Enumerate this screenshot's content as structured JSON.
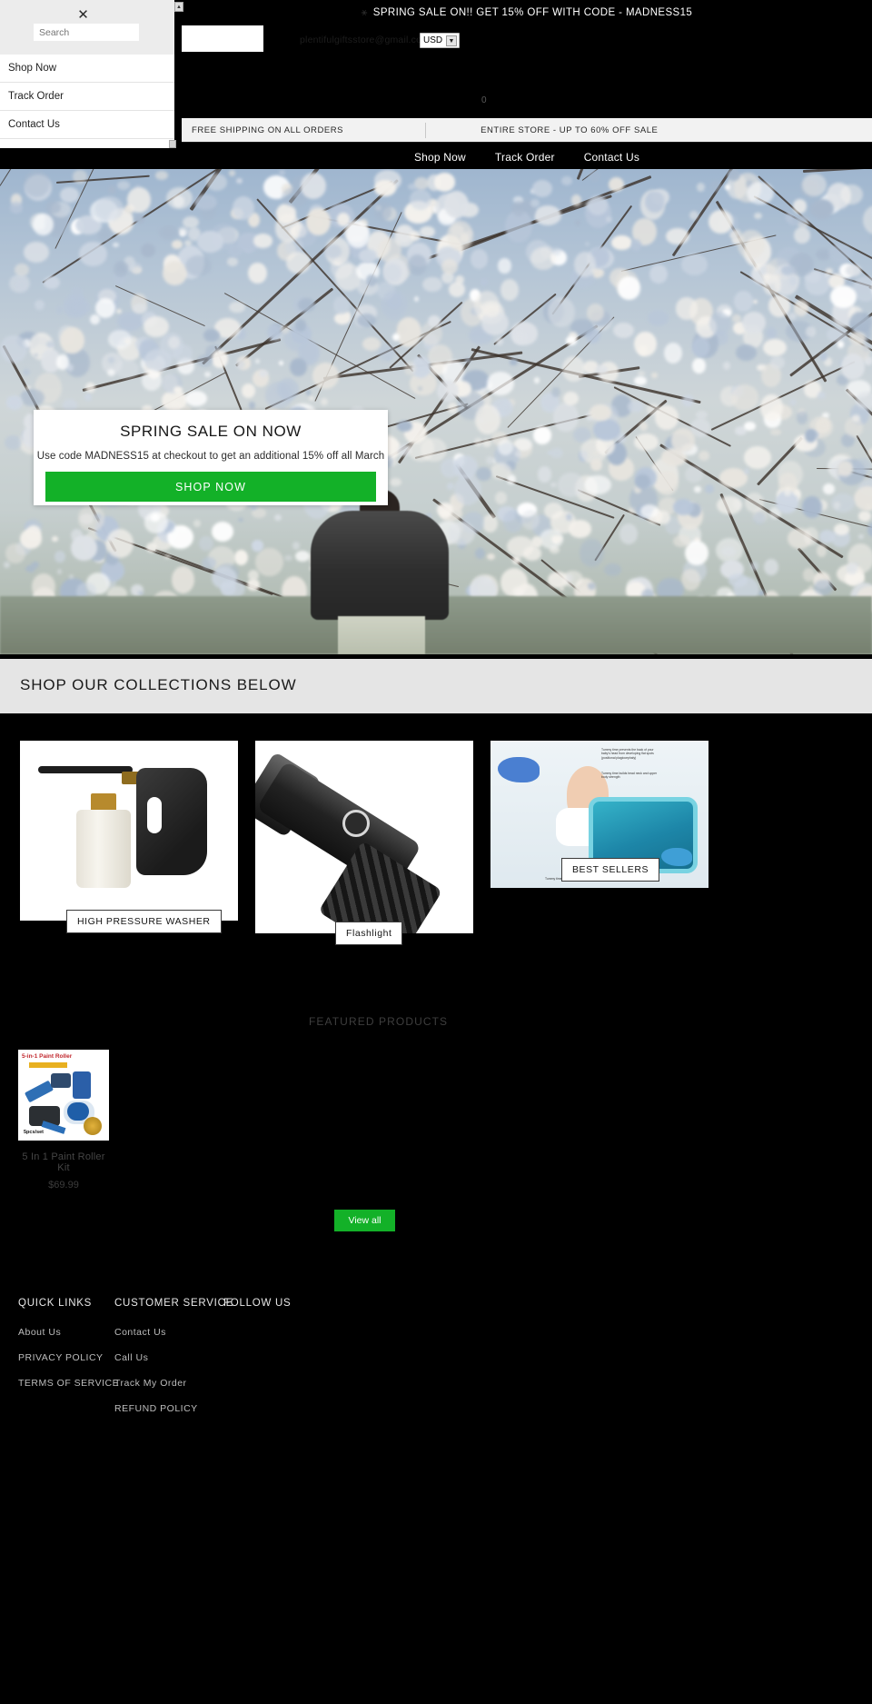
{
  "announcement": {
    "top_text": "SPRING SALE ON!!  GET 15% OFF WITH CODE - MADNESS15",
    "glyph_left": "⚹",
    "glyph_mid": "⚹"
  },
  "utility": {
    "email": "plentifulgiftsstore@gmail.com",
    "currency": "USD",
    "currency_caret": "▼",
    "cart_glyph": "0"
  },
  "info_bar": {
    "left": "FREE SHIPPING ON ALL ORDERS",
    "right": "ENTIRE STORE - UP TO 60% OFF SALE"
  },
  "nav": {
    "items": [
      {
        "label": "Shop Now"
      },
      {
        "label": "Track Order"
      },
      {
        "label": "Contact Us"
      }
    ]
  },
  "hero": {
    "promo_title": "SPRING SALE ON NOW",
    "promo_subtitle": "Use code MADNESS15 at checkout to get an additional 15% off all March",
    "promo_button": "SHOP NOW",
    "accent_green": "#13b128"
  },
  "collections": {
    "heading": "SHOP OUR COLLECTIONS BELOW",
    "cards": [
      {
        "label": "HIGH PRESSURE WASHER"
      },
      {
        "label": "Flashlight"
      },
      {
        "label": "BEST SELLERS"
      }
    ],
    "mat_notes": [
      "Tummy time prevents the back of your baby's head from developing flat spots (positional plagiocephaly)",
      "Tummy time builds head neck and upper body strength",
      "Tummy time improves baby's motor skills"
    ]
  },
  "featured": {
    "heading": "FEATURED PRODUCTS",
    "products": [
      {
        "name": "5 In 1 Paint Roller Kit",
        "price": "$69.99",
        "image_title": "5-in-1 Paint Roller",
        "image_caption": "5pcs/set"
      }
    ],
    "view_all": "View all"
  },
  "footer": {
    "columns": [
      {
        "heading": "QUICK LINKS",
        "links": [
          "About Us",
          "PRIVACY POLICY",
          "TERMS OF SERVICE"
        ]
      },
      {
        "heading": "CUSTOMER SERVICE",
        "links": [
          "Contact Us",
          "Call Us",
          "Track My Order",
          "REFUND POLICY"
        ]
      },
      {
        "heading": "FOLLOW US",
        "links": []
      }
    ]
  },
  "drawer": {
    "close_icon": "✕",
    "search_placeholder": "Search",
    "search_value": "",
    "items": [
      {
        "label": "Shop Now"
      },
      {
        "label": "Track Order"
      },
      {
        "label": "Contact Us"
      }
    ]
  }
}
